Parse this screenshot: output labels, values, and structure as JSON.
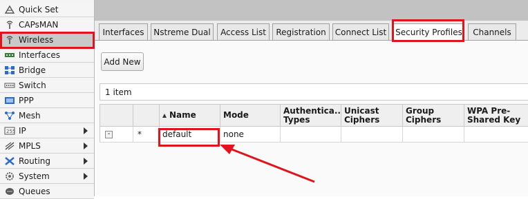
{
  "sidebar": {
    "items": [
      {
        "label": "Quick Set",
        "icon": "quick-set-icon",
        "has_submenu": false,
        "active": false
      },
      {
        "label": "CAPsMAN",
        "icon": "capsman-icon",
        "has_submenu": false,
        "active": false
      },
      {
        "label": "Wireless",
        "icon": "wireless-icon",
        "has_submenu": false,
        "active": true
      },
      {
        "label": "Interfaces",
        "icon": "interfaces-icon",
        "has_submenu": false,
        "active": false
      },
      {
        "label": "Bridge",
        "icon": "bridge-icon",
        "has_submenu": false,
        "active": false
      },
      {
        "label": "Switch",
        "icon": "switch-icon",
        "has_submenu": false,
        "active": false
      },
      {
        "label": "PPP",
        "icon": "ppp-icon",
        "has_submenu": false,
        "active": false
      },
      {
        "label": "Mesh",
        "icon": "mesh-icon",
        "has_submenu": false,
        "active": false
      },
      {
        "label": "IP",
        "icon": "ip-icon",
        "has_submenu": true,
        "active": false
      },
      {
        "label": "MPLS",
        "icon": "mpls-icon",
        "has_submenu": true,
        "active": false
      },
      {
        "label": "Routing",
        "icon": "routing-icon",
        "has_submenu": true,
        "active": false
      },
      {
        "label": "System",
        "icon": "gear-icon",
        "has_submenu": true,
        "active": false
      },
      {
        "label": "Queues",
        "icon": "queues-icon",
        "has_submenu": false,
        "active": false
      }
    ]
  },
  "tabs": [
    {
      "label": "Interfaces",
      "active": false
    },
    {
      "label": "Nstreme Dual",
      "active": false
    },
    {
      "label": "Access List",
      "active": false
    },
    {
      "label": "Registration",
      "active": false
    },
    {
      "label": "Connect List",
      "active": false
    },
    {
      "label": "Security Profiles",
      "active": true
    },
    {
      "label": "Channels",
      "active": false
    }
  ],
  "toolbar": {
    "add_new_label": "Add New"
  },
  "item_count": "1 item",
  "table": {
    "columns": [
      "",
      "",
      "Name",
      "Mode",
      "Authentica... Types",
      "Unicast Ciphers",
      "Group Ciphers",
      "WPA Pre-Shared Key"
    ],
    "sorted_column": "Name",
    "rows": [
      {
        "marker": "*",
        "name": "default",
        "mode": "none",
        "auth_types": "",
        "unicast_ciphers": "",
        "group_ciphers": "",
        "wpa_psk": ""
      }
    ]
  },
  "annotation": {
    "highlight_color": "#e0141c"
  }
}
